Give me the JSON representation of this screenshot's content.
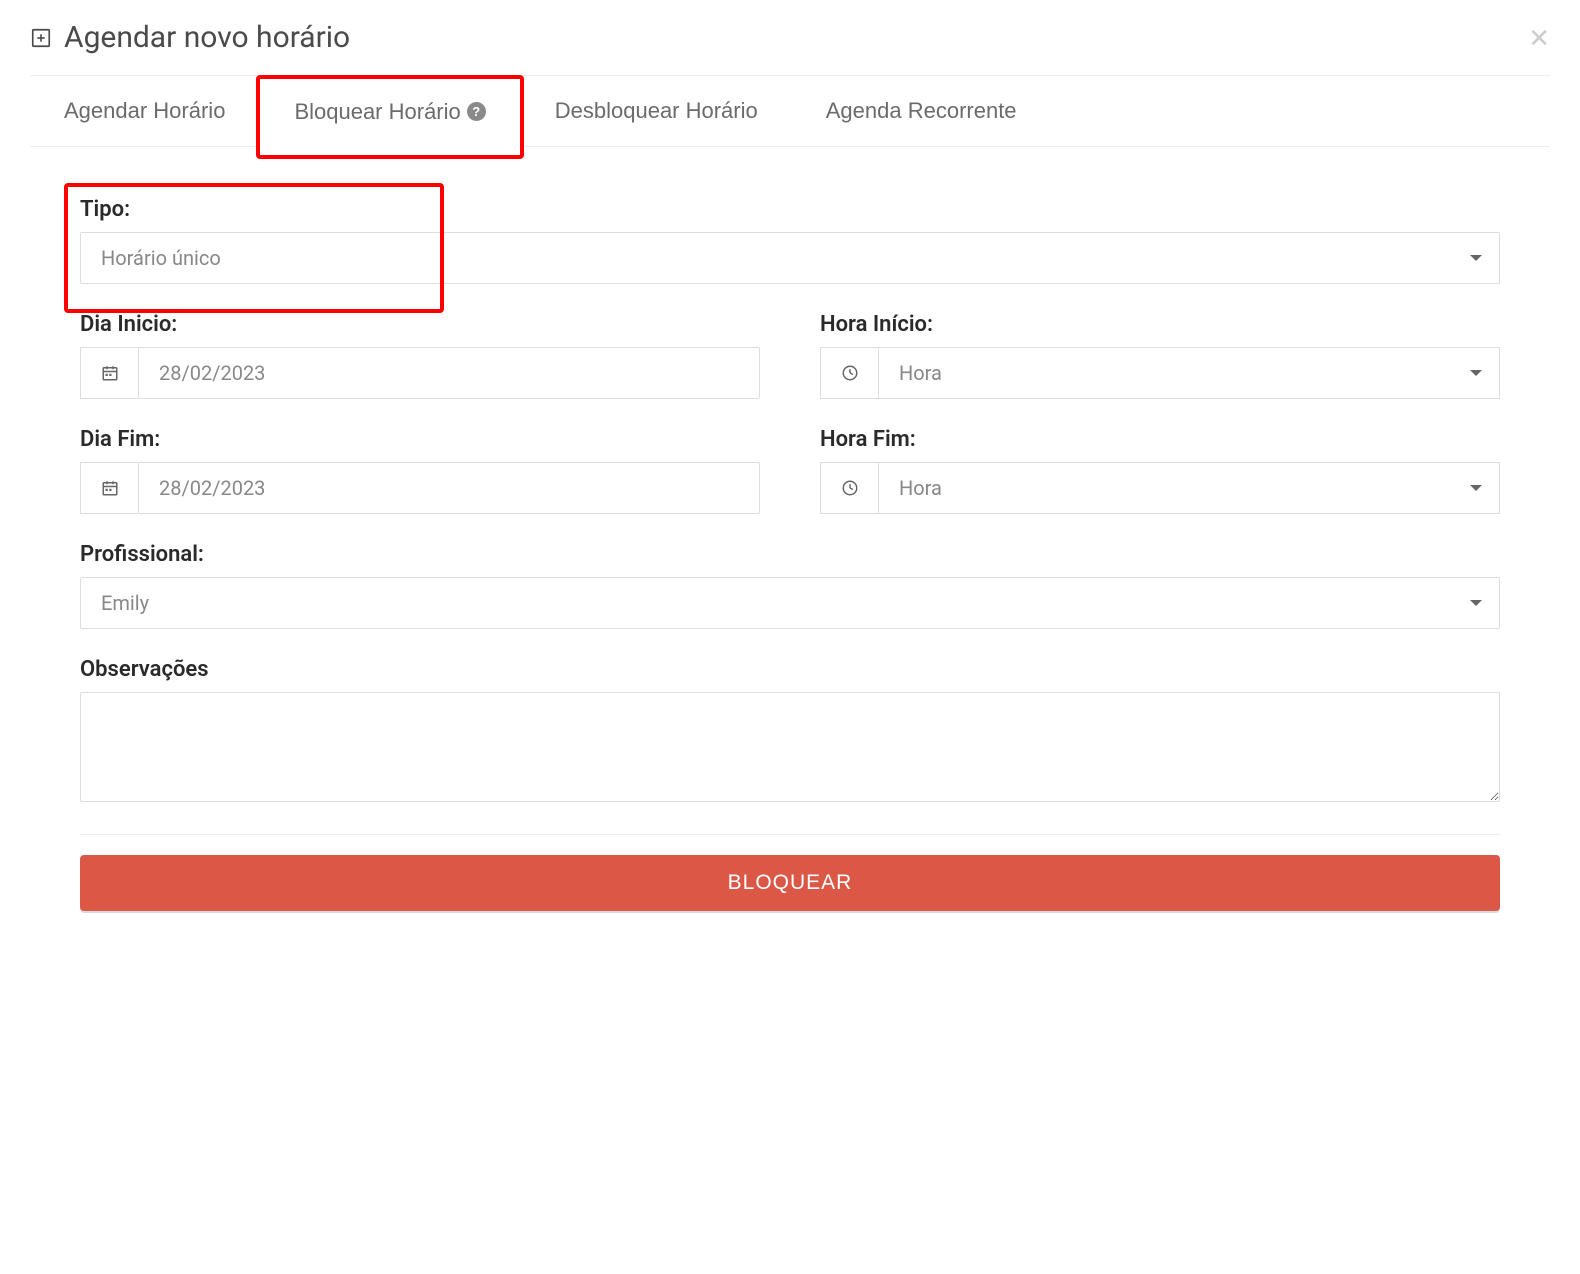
{
  "header": {
    "title": "Agendar novo horário"
  },
  "tabs": {
    "agendar": "Agendar Horário",
    "bloquear": "Bloquear Horário",
    "desbloquear": "Desbloquear Horário",
    "recorrente": "Agenda Recorrente"
  },
  "form": {
    "tipo_label": "Tipo:",
    "tipo_value": "Horário único",
    "dia_inicio_label": "Dia Inicio:",
    "dia_inicio_value": "28/02/2023",
    "hora_inicio_label": "Hora Início:",
    "hora_inicio_value": "Hora",
    "dia_fim_label": "Dia Fim:",
    "dia_fim_value": "28/02/2023",
    "hora_fim_label": "Hora Fim:",
    "hora_fim_value": "Hora",
    "profissional_label": "Profissional:",
    "profissional_value": "Emily",
    "observacoes_label": "Observações",
    "observacoes_value": ""
  },
  "actions": {
    "bloquear": "BLOQUEAR"
  }
}
